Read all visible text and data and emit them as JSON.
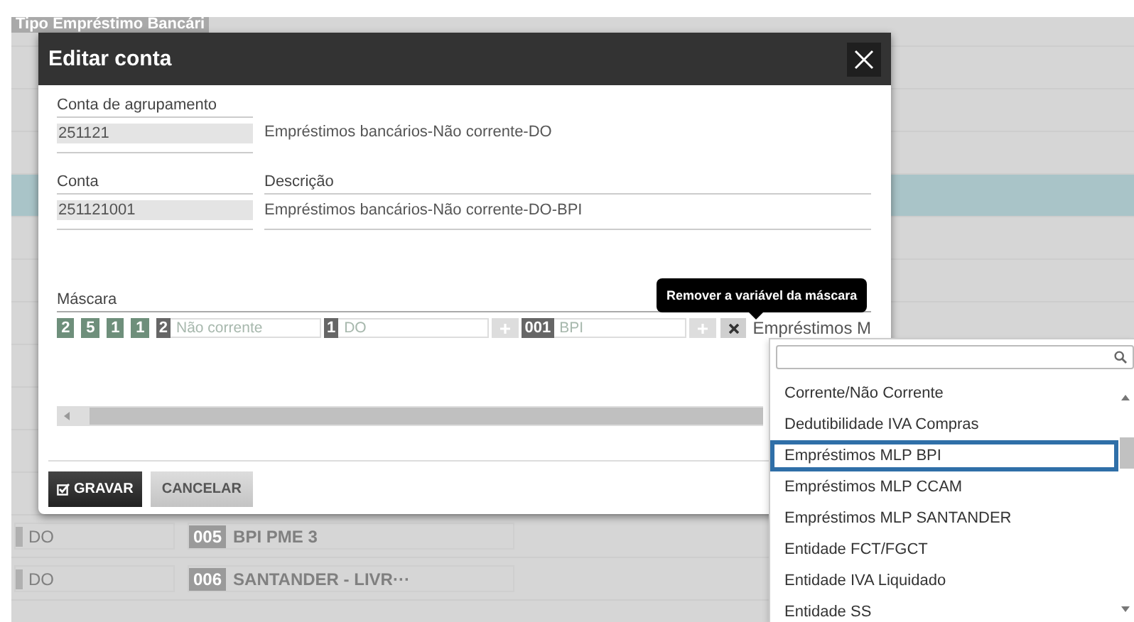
{
  "background_table": {
    "header": "Tipo Empréstimo Bancári",
    "rows": [
      {
        "selected": false
      },
      {
        "selected": false
      },
      {
        "selected": false
      },
      {
        "selected": true
      },
      {
        "selected": false
      },
      {
        "selected": false
      },
      {
        "selected": false
      },
      {
        "selected": false
      },
      {
        "selected": false
      },
      {
        "selected": false
      },
      {
        "selected": false
      },
      {
        "selected": false,
        "column_1": "DO",
        "code": "005",
        "name": "BPI PME 3"
      },
      {
        "selected": false,
        "column_1": "DO",
        "code": "006",
        "name": "SANTANDER - LIVR···"
      },
      {
        "selected": false
      }
    ]
  },
  "dialog": {
    "title": "Editar conta",
    "group_account": {
      "label": "Conta de agrupamento",
      "code": "251121",
      "description": "Empréstimos bancários-Não corrente-DO"
    },
    "account": {
      "code_label": "Conta",
      "description_label": "Descrição",
      "code": "251121001",
      "description": "Empréstimos bancários-Não corrente-DO-BPI"
    },
    "mask": {
      "label": "Máscara",
      "segments": [
        {
          "kind": "digit",
          "text": "2"
        },
        {
          "kind": "digit",
          "text": "5"
        },
        {
          "kind": "digit",
          "text": "1"
        },
        {
          "kind": "digit",
          "text": "1"
        },
        {
          "kind": "field",
          "badge": "2",
          "value": "Não corrente"
        },
        {
          "kind": "field",
          "badge": "1",
          "value": "DO"
        },
        {
          "kind": "add"
        },
        {
          "kind": "field",
          "badge": "001",
          "value": "BPI"
        },
        {
          "kind": "add"
        },
        {
          "kind": "remove"
        },
        {
          "kind": "select",
          "value": "Empréstimos M"
        }
      ]
    },
    "tooltip": "Remover a variável da máscara",
    "buttons": [
      {
        "kind": "primary",
        "label": "GRAVAR"
      },
      {
        "kind": "secondary",
        "label": "CANCELAR"
      }
    ]
  },
  "dropdown": {
    "options": [
      {
        "label": "Corrente/Não Corrente",
        "selected": false
      },
      {
        "label": "Dedutibilidade IVA Compras",
        "selected": false
      },
      {
        "label": "Empréstimos MLP BPI",
        "selected": true
      },
      {
        "label": "Empréstimos MLP CCAM",
        "selected": false
      },
      {
        "label": "Empréstimos MLP SANTANDER",
        "selected": false
      },
      {
        "label": "Entidade FCT/FGCT",
        "selected": false
      },
      {
        "label": "Entidade IVA Liquidado",
        "selected": false
      },
      {
        "label": "Entidade SS",
        "selected": false
      }
    ]
  }
}
